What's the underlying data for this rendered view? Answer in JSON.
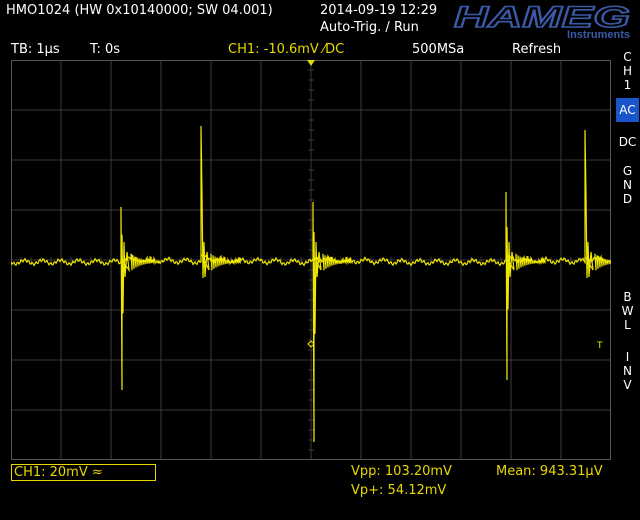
{
  "header": {
    "device_id": "HMO1024 (HW 0x10140000; SW 04.001)",
    "datetime": "2014-09-19 12:29",
    "trigger_state": "Auto-Trig. / Run",
    "brand": "HAMEG",
    "brand_sub": "Instruments"
  },
  "status": {
    "timebase": "TB: 1µs",
    "trigger_time": "T: 0s",
    "trigger_level": "CH1: -10.6mV ⁄DC",
    "sample_rate": "500MSa",
    "acq_mode": "Refresh"
  },
  "side_menu": {
    "title": [
      "C",
      "H",
      "1"
    ],
    "ac": "AC",
    "dc": "DC",
    "gnd": [
      "G",
      "N",
      "D"
    ],
    "bwl": [
      "B",
      "W",
      "L"
    ],
    "inv": [
      "I",
      "N",
      "V"
    ]
  },
  "screen": {
    "ch_marker": "1",
    "trigger_marker": "T",
    "trace_color": "#f0e800",
    "grid_color": "#3a3a3a"
  },
  "bottom": {
    "ch_scale": "CH1: 20mV ≈",
    "vpp": "Vpp: 103.20mV",
    "vp_plus": "Vp+: 54.12mV",
    "mean": "Mean: 943.31µV"
  },
  "colors": {
    "accent_yellow": "#e8d800",
    "active_blue": "#1a55c9",
    "logo_blue": "#3a5aa8"
  },
  "icons": {
    "trigger_position": "down-triangle-marker",
    "channel_offset": "right-arrow-marker",
    "trigger_time": "diamond-marker"
  }
}
